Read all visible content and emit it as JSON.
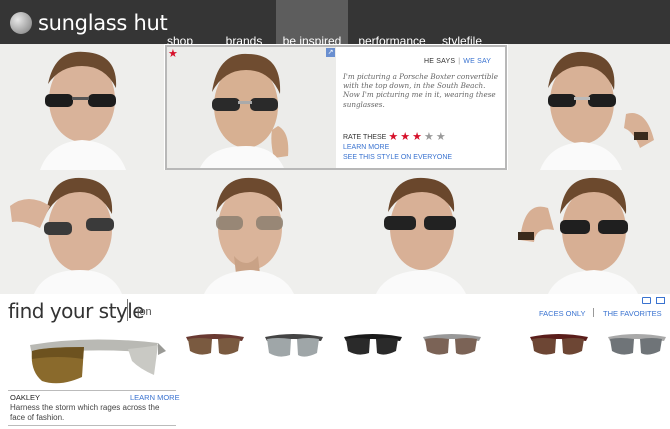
{
  "app": {
    "logo_text": "sunglass hut"
  },
  "nav": {
    "items": [
      {
        "label": "shop"
      },
      {
        "label": "brands"
      },
      {
        "label": "be inspired",
        "active": true
      },
      {
        "label": "performance"
      },
      {
        "label": "stylefile"
      }
    ]
  },
  "popup": {
    "he_says": "HE SAYS",
    "we_say": "WE SAY",
    "quote": "I'm picturing a Porsche Boxter convertible with the top down, in the South Beach. Now I'm picturing me in it, wearing these sunglasses.",
    "rate_label": "RATE THESE",
    "rating": 3,
    "rating_max": 5,
    "learn_more": "LEARN MORE",
    "see_style": "SEE THIS STYLE ON EVERYONE"
  },
  "find": {
    "title": "find your style",
    "user": "jon",
    "faces_only": "FACES ONLY",
    "favorites": "THE FAVORITES"
  },
  "featured": {
    "brand": "OAKLEY",
    "learn_more": "LEARN MORE",
    "description": "Harness the storm which rages across the face of fashion."
  },
  "colors": {
    "topbar": "#353535",
    "nav_active": "#5d5d5d",
    "link": "#3a73d0",
    "accent_red": "#d6102a"
  },
  "icons": [
    "folder-icon",
    "mail-icon",
    "star-icon",
    "expand-icon"
  ]
}
